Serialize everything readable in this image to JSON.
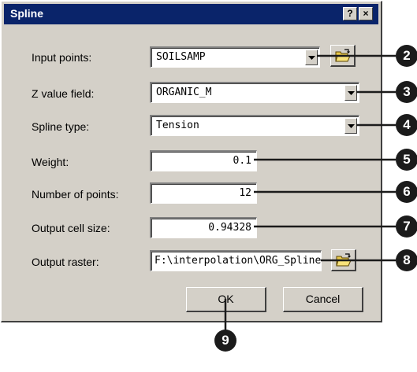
{
  "window": {
    "title": "Spline",
    "help_label": "?",
    "close_label": "×"
  },
  "fields": {
    "input_points": {
      "label": "Input points:",
      "value": "SOILSAMP"
    },
    "z_value_field": {
      "label": "Z value field:",
      "value": "ORGANIC_M"
    },
    "spline_type": {
      "label": "Spline type:",
      "value": "Tension"
    },
    "weight": {
      "label": "Weight:",
      "value": "0.1"
    },
    "number_of_points": {
      "label": "Number of points:",
      "value": "12"
    },
    "output_cell_size": {
      "label": "Output cell size:",
      "value": "0.94328"
    },
    "output_raster": {
      "label": "Output raster:",
      "value": "F:\\interpolation\\ORG_Spline"
    }
  },
  "buttons": {
    "ok": "OK",
    "cancel": "Cancel"
  },
  "callouts": [
    "2",
    "3",
    "4",
    "5",
    "6",
    "7",
    "8",
    "9"
  ],
  "colors": {
    "dialog_bg": "#d4d0c8",
    "titlebar": "#0a246a",
    "callout_bg": "#1b1b1b"
  },
  "icons": [
    "help-icon",
    "close-icon",
    "chevron-down-icon",
    "open-folder-icon"
  ]
}
